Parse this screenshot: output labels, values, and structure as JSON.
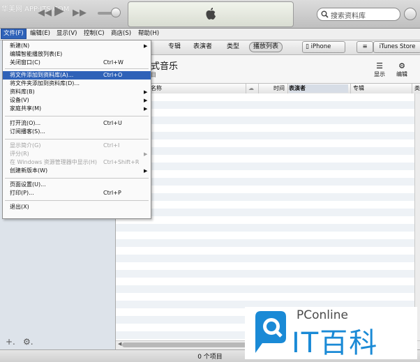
{
  "watermark_text": "华美网 APP·ITS.COM",
  "search": {
    "placeholder": "搜索资料库"
  },
  "menubar": [
    {
      "label": "文件(F)"
    },
    {
      "label": "编辑(E)"
    },
    {
      "label": "显示(V)"
    },
    {
      "label": "控制(C)"
    },
    {
      "label": "商店(S)"
    },
    {
      "label": "帮助(H)"
    }
  ],
  "tabs": [
    {
      "label": "专辑"
    },
    {
      "label": "表演者"
    },
    {
      "label": "类型"
    },
    {
      "label": "播放列表"
    }
  ],
  "toolbar": {
    "iphone_label": "iPhone",
    "store_label": "iTunes Store"
  },
  "header": {
    "title": "式音乐",
    "subtitle": "目",
    "show_label": "显示",
    "edit_label": "编辑"
  },
  "columns": {
    "name": "名称",
    "time": "时间",
    "artist": "表演者",
    "album": "专辑",
    "extra": "类"
  },
  "status": {
    "text": "0 个项目"
  },
  "file_menu": [
    {
      "label": "新建(N)",
      "shortcut": "",
      "submenu": true,
      "state": "normal"
    },
    {
      "label": "编辑智能播放列表(E)",
      "shortcut": "",
      "submenu": false,
      "state": "normal"
    },
    {
      "label": "关闭窗口(C)",
      "shortcut": "Ctrl+W",
      "submenu": false,
      "state": "normal"
    },
    {
      "sep": true
    },
    {
      "label": "将文件添加到资料库(A)...",
      "shortcut": "Ctrl+O",
      "submenu": false,
      "state": "highlight"
    },
    {
      "label": "将文件夹添加到资料库(D)...",
      "shortcut": "",
      "submenu": false,
      "state": "normal"
    },
    {
      "label": "资料库(B)",
      "shortcut": "",
      "submenu": true,
      "state": "normal"
    },
    {
      "label": "设备(V)",
      "shortcut": "",
      "submenu": true,
      "state": "normal"
    },
    {
      "label": "家庭共享(M)",
      "shortcut": "",
      "submenu": true,
      "state": "normal"
    },
    {
      "sep": true
    },
    {
      "label": "打开流(O)...",
      "shortcut": "Ctrl+U",
      "submenu": false,
      "state": "normal"
    },
    {
      "label": "订阅播客(S)...",
      "shortcut": "",
      "submenu": false,
      "state": "normal"
    },
    {
      "sep": true
    },
    {
      "label": "显示简介(G)",
      "shortcut": "Ctrl+I",
      "submenu": false,
      "state": "disabled"
    },
    {
      "label": "评分(R)",
      "shortcut": "",
      "submenu": true,
      "state": "disabled"
    },
    {
      "label": "在 Windows 资源管理器中显示(H)",
      "shortcut": "Ctrl+Shift+R",
      "submenu": false,
      "state": "disabled"
    },
    {
      "label": "创建新版本(W)",
      "shortcut": "",
      "submenu": true,
      "state": "normal"
    },
    {
      "sep": true
    },
    {
      "label": "页面设置(U)...",
      "shortcut": "",
      "submenu": false,
      "state": "normal"
    },
    {
      "label": "打印(P)...",
      "shortcut": "Ctrl+P",
      "submenu": false,
      "state": "normal"
    },
    {
      "sep": true
    },
    {
      "label": "退出(X)",
      "shortcut": "",
      "submenu": false,
      "state": "normal"
    }
  ],
  "logo": {
    "brand": "PConline",
    "name": "IT百科"
  }
}
